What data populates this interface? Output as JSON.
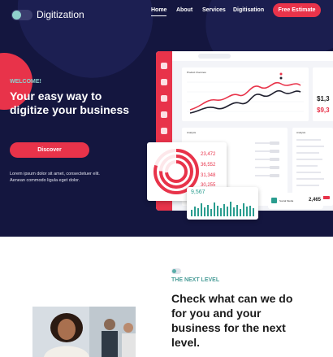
{
  "nav": {
    "brand": "Digitization",
    "links": [
      "Home",
      "About",
      "Services",
      "Digitisation"
    ],
    "cta": "Free Estimate"
  },
  "hero": {
    "kicker": "WELCOME!",
    "headline": "Your easy way to digitize your business",
    "button": "Discover",
    "body": "Lorem ipsum dolor sit amet, consectetuer elit. Aenean commodo ligula eget dolor."
  },
  "dashboard": {
    "chart_title": "Product Overview",
    "stat_values": [
      "$1,3",
      "$9,3"
    ],
    "panel_labels": [
      "Analysis",
      "Analysis"
    ],
    "float_values": [
      "23,472",
      "36,552",
      "31,348",
      "30,255"
    ],
    "bar_value": "9,567",
    "social": {
      "label": "Social Media",
      "value": "2,465"
    },
    "colors": {
      "accent": "#e8334a",
      "teal": "#2a9d8f",
      "navy": "#14163f"
    }
  },
  "feature": {
    "kicker": "THE NEXT LEVEL",
    "title": "Check what can we do for you and your business for the next level."
  },
  "images": {
    "team_photo": "team-photo"
  }
}
